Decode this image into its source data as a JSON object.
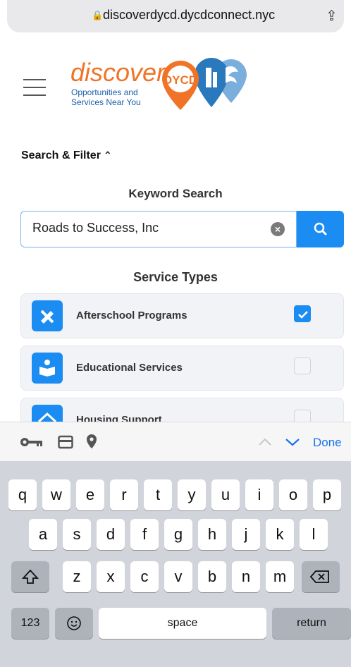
{
  "browser": {
    "url": "discoverdycd.dycdconnect.nyc"
  },
  "header": {
    "logo_word": "discover",
    "logo_sub_line1": "Opportunities and",
    "logo_sub_line2": "Services Near You",
    "logo_badge": "DYCD"
  },
  "filter": {
    "title": "Search & Filter"
  },
  "keyword": {
    "label": "Keyword Search",
    "value": "Roads to Success, Inc"
  },
  "services": {
    "label": "Service Types",
    "items": [
      {
        "label": "Afterschool Programs",
        "checked": true
      },
      {
        "label": "Educational Services",
        "checked": false
      },
      {
        "label": "Housing Support",
        "checked": false
      }
    ]
  },
  "accessory": {
    "done_label": "Done"
  },
  "keyboard": {
    "row1": [
      "q",
      "w",
      "e",
      "r",
      "t",
      "y",
      "u",
      "i",
      "o",
      "p"
    ],
    "row2": [
      "a",
      "s",
      "d",
      "f",
      "g",
      "h",
      "j",
      "k",
      "l"
    ],
    "row3": [
      "z",
      "x",
      "c",
      "v",
      "b",
      "n",
      "m"
    ],
    "numbers_label": "123",
    "space_label": "space",
    "return_label": "return"
  },
  "colors": {
    "accent": "#1b8cf2",
    "brand_orange": "#f07427",
    "brand_blue": "#1b5ea8"
  }
}
